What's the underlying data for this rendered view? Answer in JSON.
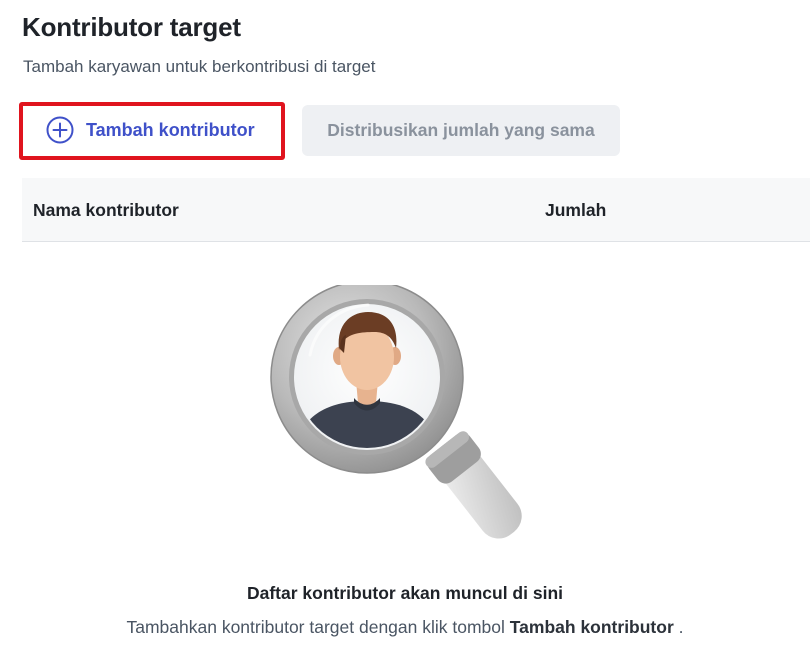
{
  "header": {
    "title": "Kontributor target",
    "subtitle": "Tambah karyawan untuk berkontribusi di target"
  },
  "toolbar": {
    "add_label": "Tambah kontributor",
    "add_icon": "plus-circle-icon",
    "distribute_label": "Distribusikan jumlah yang sama",
    "highlight_color": "#e0141e",
    "accent_color": "#3f51c9"
  },
  "table": {
    "columns": [
      "Nama kontributor",
      "Jumlah"
    ],
    "rows": []
  },
  "empty_state": {
    "illustration": "magnifier-person-icon",
    "title": "Daftar kontributor akan muncul di sini",
    "description_prefix": "Tambahkan kontributor target dengan klik tombol",
    "description_emphasis": "Tambah kontributor",
    "description_suffix": "."
  }
}
